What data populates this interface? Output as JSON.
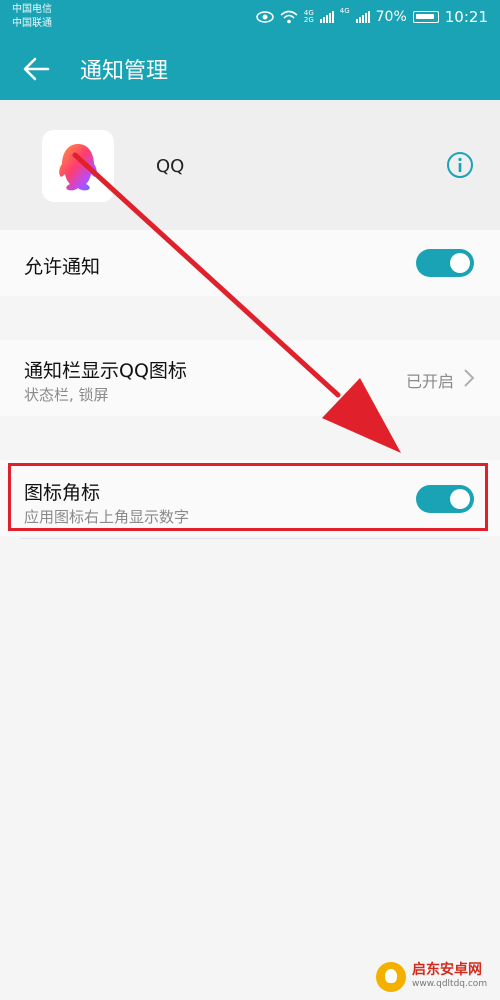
{
  "status_bar": {
    "carrier1": "中国电信",
    "carrier2": "中国联通",
    "net1": "4G",
    "net1b": "2G",
    "net2": "4G",
    "battery": "70%",
    "time": "10:21"
  },
  "app_bar": {
    "title": "通知管理"
  },
  "app": {
    "name": "QQ"
  },
  "settings": {
    "allow_notify": {
      "label": "允许通知",
      "enabled": true
    },
    "notification_bar": {
      "label": "通知栏显示QQ图标",
      "sub": "状态栏, 锁屏",
      "value": "已开启"
    },
    "badge": {
      "label": "图标角标",
      "sub": "应用图标右上角显示数字",
      "enabled": true
    }
  },
  "watermark": {
    "title": "启东安卓网",
    "url": "www.qdltdq.com"
  },
  "colors": {
    "accent": "#1aa3b5",
    "annotation": "#e0202a"
  }
}
